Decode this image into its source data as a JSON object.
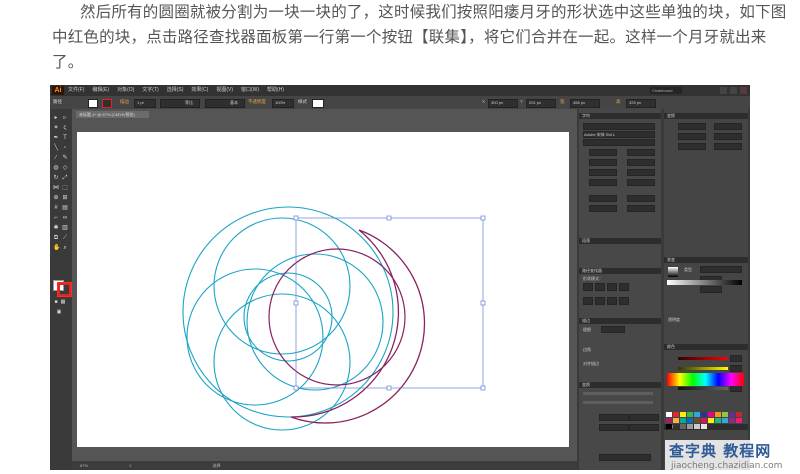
{
  "caption": "然后所有的圆圈就被分割为一块一块的了，这时候我们按照阳痿月牙的形状选中这些单独的块，如下图中红色的块，点击路径查找器面板第一行第一个按钮【联集】，将它们合并在一起。这样一个月牙就出来了。",
  "app": {
    "logo": "Ai",
    "menus": [
      "文件(F)",
      "编辑(E)",
      "对象(O)",
      "文字(T)",
      "选择(S)",
      "效果(C)",
      "视图(V)",
      "窗口(W)",
      "帮助(H)"
    ],
    "workspace": "Chalkboard",
    "control_bar": {
      "path_label": "路径",
      "stroke_label": "描边",
      "stroke_value": "1 pt",
      "line_uniform": "等比",
      "brush_label": "基本",
      "opacity_label": "不透明度",
      "opacity_value": "100%",
      "style_label": "样式",
      "x_label": "X",
      "x_value": "300 px",
      "y_label": "Y",
      "y_value": "201 px",
      "w_label": "宽",
      "w_value": "456 px",
      "h_label": "高",
      "h_value": "325 px"
    },
    "document_tab": "未标题-1* @ 67% (CMYK/预览)",
    "status": {
      "zoom": "67%",
      "page": "1",
      "tool": "选择"
    }
  },
  "panels": {
    "character_title": "字符",
    "font_name": "Adobe 宋体 Std L",
    "paragraph_title": "段落",
    "pathfinder_title": "路径查找器",
    "pathfinder_mode": "形状模式：",
    "stroke_title": "描边",
    "stroke_weight_label": "粗细",
    "corner_label": "边角",
    "align_stroke_label": "对齐描边",
    "transform_title": "变换",
    "gradient_title": "渐变",
    "gradient_type_label": "类型",
    "color_title": "颜色",
    "swatches_title": "色板",
    "transparency_label": "透明度"
  },
  "watermark": {
    "main": "查字典 教程网",
    "url": "jiaocheng.chazidian.com"
  },
  "colors": {
    "cyan_circle": "#1aa3c4",
    "magenta_circle": "#8a2160",
    "selection": "#5f7fd6",
    "highlight_red": "#e3241f"
  }
}
